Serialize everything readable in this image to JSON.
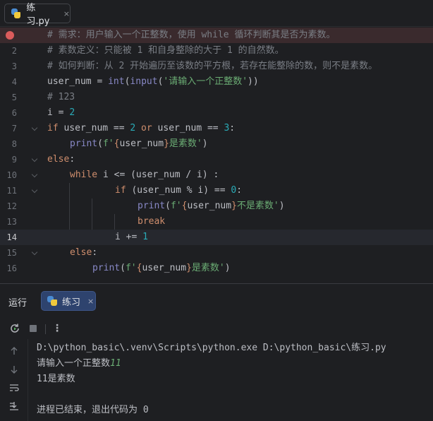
{
  "editor_tab": {
    "filename": "练习.py",
    "close": "×"
  },
  "gutter": [
    "1",
    "2",
    "3",
    "4",
    "5",
    "6",
    "7",
    "8",
    "9",
    "10",
    "11",
    "12",
    "13",
    "14",
    "15",
    "16"
  ],
  "code": {
    "l1": "# 需求：用户输入一个正整数，使用 while 循环判断其是否为素数。",
    "l2": "# 素数定义：只能被 1 和自身整除的大于 1 的自然数。",
    "l3": "# 如何判断：从 2 开始遍历至该数的平方根，若存在能整除的数，则不是素数。",
    "l4": {
      "var": "user_num",
      "eq": " = ",
      "int": "int",
      "p1": "(",
      "input": "input",
      "p2": "(",
      "str": "'请输入一个正整数'",
      "p3": "))"
    },
    "l5": "# 123",
    "l6": {
      "var": "i",
      "eq": " = ",
      "num": "2"
    },
    "l7": {
      "if": "if",
      "a": " user_num == ",
      "n1": "2",
      "or": " or",
      "b": " user_num == ",
      "n2": "3",
      "c": ":"
    },
    "l8": {
      "print": "print",
      "p1": "(",
      "s1": "f'",
      "b1": "{",
      "v": "user_num",
      "b2": "}",
      "s2": "是素数'",
      "p2": ")"
    },
    "l9": {
      "else": "else",
      "c": ":"
    },
    "l10": {
      "while": "while",
      "rest": " i <= (user_num / i) :"
    },
    "l11": {
      "if": "if",
      "a": " (user_num % i) == ",
      "n": "0",
      "c": ":"
    },
    "l12": {
      "print": "print",
      "p1": "(",
      "s1": "f'",
      "b1": "{",
      "v": "user_num",
      "b2": "}",
      "s2": "不是素数'",
      "p2": ")"
    },
    "l13": {
      "break": "break"
    },
    "l14": {
      "a": "i += ",
      "n": "1"
    },
    "l15": {
      "else": "else",
      "c": ":"
    },
    "l16": {
      "print": "print",
      "p1": "(",
      "s1": "f'",
      "b1": "{",
      "v": "user_num",
      "b2": "}",
      "s2": "是素数'",
      "p2": ")"
    }
  },
  "run_panel": {
    "label": "运行",
    "tab_name": "练习",
    "close": "×",
    "more": "⋮"
  },
  "console": {
    "command": "D:\\python_basic\\.venv\\Scripts\\python.exe D:\\python_basic\\练习.py",
    "prompt": "请输入一个正整数",
    "user_input": "11",
    "result": "11是素数",
    "exit": "进程已结束，退出代码为 0"
  },
  "colors": {
    "background": "#1e1f22",
    "keyword": "#cf8e6d",
    "string": "#6aab73",
    "number": "#2aacb8",
    "builtin": "#8888c6",
    "comment": "#7a7e85",
    "breakpoint": "#db5c5c",
    "run_tab": "#2e436e"
  }
}
